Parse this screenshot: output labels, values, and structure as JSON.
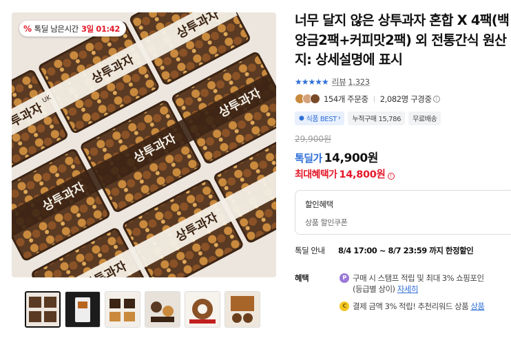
{
  "gallery": {
    "timer_badge": {
      "icon": "percent-icon",
      "label": "톡딜 남은시간",
      "time": "3일 01:42"
    },
    "package_text": "상투과자",
    "package_brand": "UK",
    "thumbnail_count": 6
  },
  "product": {
    "title": "너무 달지 않은 상투과자 혼합 X 4팩(백앙금2팩+커피맛2팩) 외 전통간식 원산지: 상세설명에 표시",
    "rating_stars": "★★★★★",
    "review_label": "리뷰",
    "review_count": "1,323",
    "order_count": "154개 주문중",
    "subscriber_count": "2,082명 구경중",
    "info_symbol": "i",
    "tags": [
      {
        "label": "식품 BEST",
        "suffix": "›",
        "icon": "badge-dot-icon"
      },
      {
        "label": "누적구매 15,786"
      },
      {
        "label": "무료배송"
      }
    ],
    "original_price": "29,900원",
    "deal_label": "톡딜가",
    "deal_price": "14,900원",
    "max_label": "최대혜택가",
    "max_price": "14,800원",
    "max_info_symbol": "!",
    "discount_box": {
      "title": "할인혜택",
      "subtitle": "상품 할인쿠폰"
    },
    "deal_info": {
      "key": "톡딜 안내",
      "value": "8/4 17:00 ~ 8/7 23:59 까지 한정할인"
    },
    "perks": {
      "key": "혜택",
      "items": [
        {
          "icon_text": "P",
          "text": "구매 시 스탬프 적립 및 최대 3% 쇼핑포인",
          "text2": "(등급별 상이)",
          "link": "자세히"
        },
        {
          "icon_text": "C",
          "text": "결제 금액 3% 적립! 추천리워드 상품",
          "link": "상품"
        }
      ]
    }
  },
  "colors": {
    "accent_blue": "#2f6fd8",
    "accent_red": "#e5192a"
  }
}
